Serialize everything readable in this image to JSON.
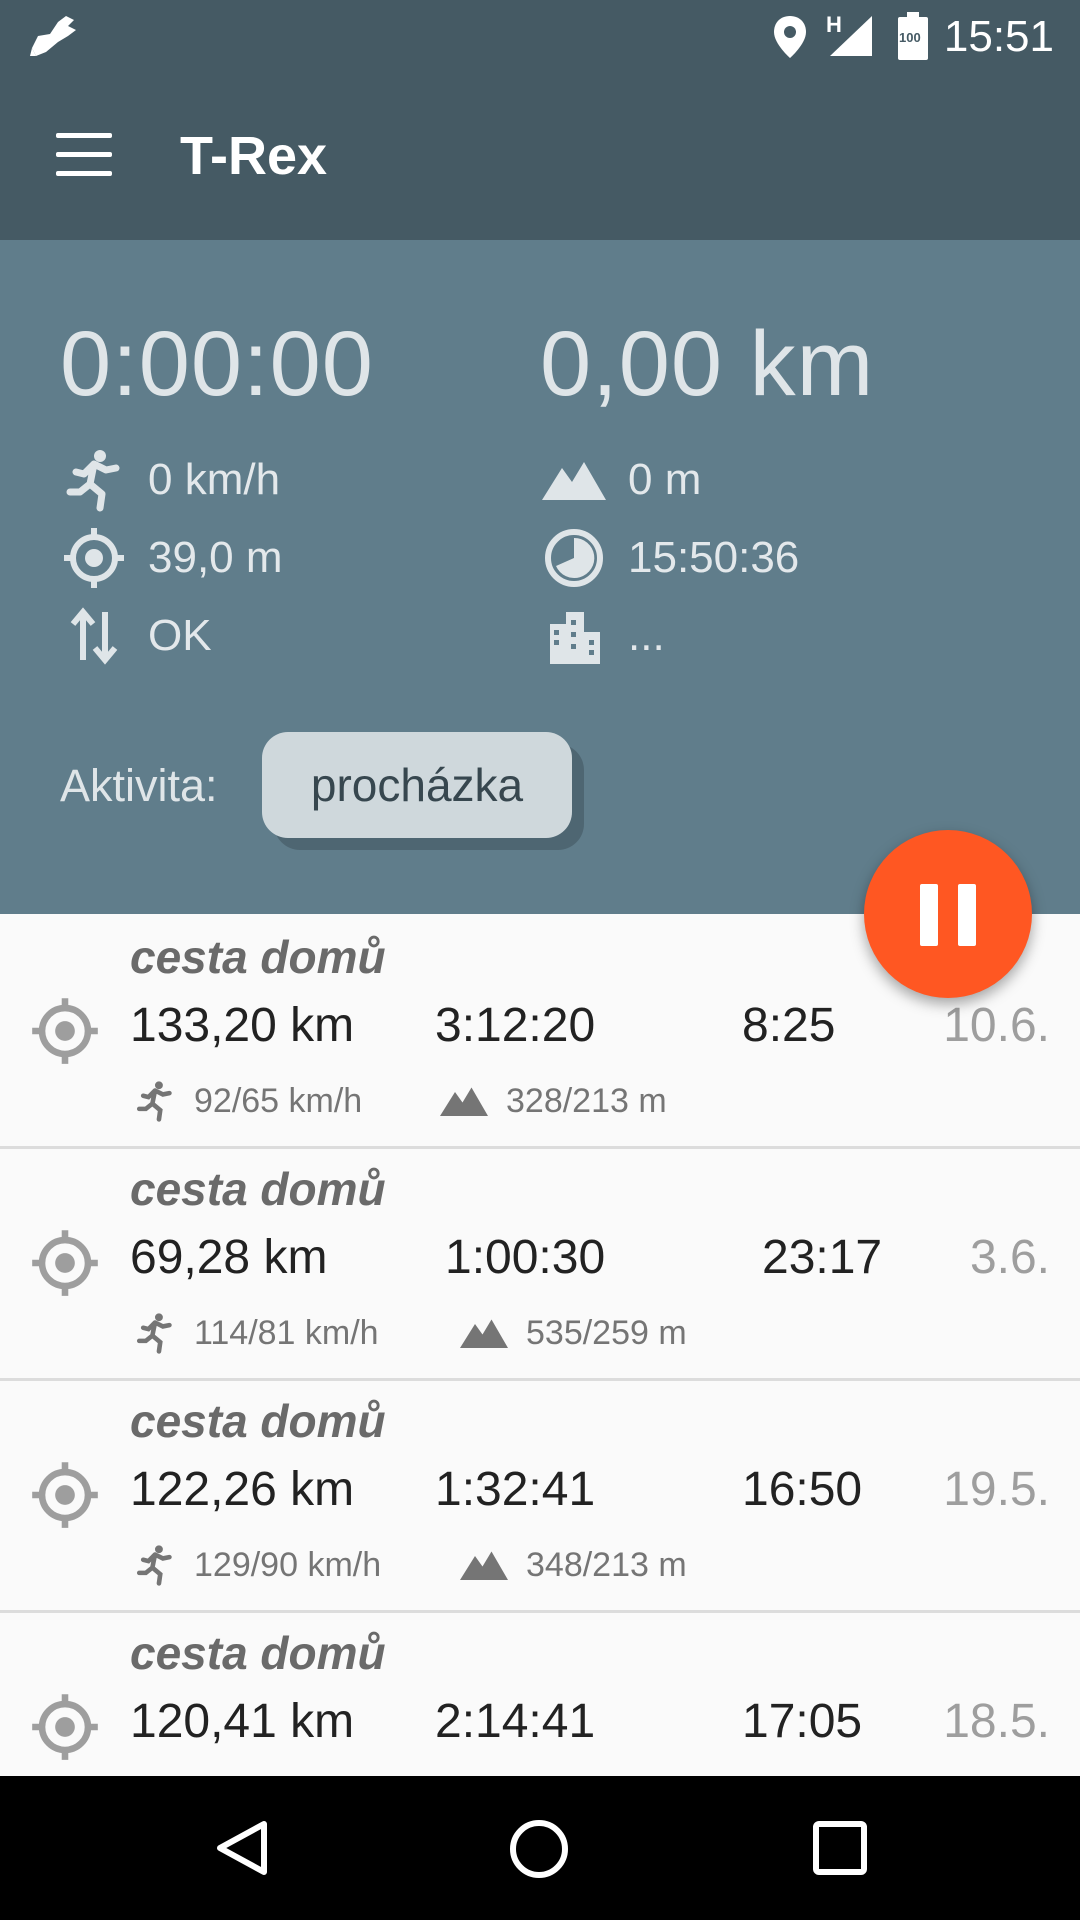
{
  "status_bar": {
    "time": "15:51",
    "network": "H",
    "battery": "100"
  },
  "app_bar": {
    "title": "T-Rex"
  },
  "stats": {
    "elapsed": "0:00:00",
    "distance": "0,00 km",
    "speed": "0 km/h",
    "accuracy": "39,0 m",
    "sync": "OK",
    "altitude": "0 m",
    "clock": "15:50:36",
    "location": "..."
  },
  "activity": {
    "label": "Aktivita:",
    "value": "procházka"
  },
  "trips": [
    {
      "title": "cesta domů",
      "distance": "133,20 km",
      "duration": "3:12:20",
      "pace": "8:25",
      "date": "10.6.",
      "speed": "92/65 km/h",
      "elevation": "328/213 m"
    },
    {
      "title": "cesta domů",
      "distance": "69,28 km",
      "duration": "1:00:30",
      "pace": "23:17",
      "date": "3.6.",
      "speed": "114/81 km/h",
      "elevation": "535/259 m"
    },
    {
      "title": "cesta domů",
      "distance": "122,26 km",
      "duration": "1:32:41",
      "pace": "16:50",
      "date": "19.5.",
      "speed": "129/90 km/h",
      "elevation": "348/213 m"
    },
    {
      "title": "cesta domů",
      "distance": "120,41 km",
      "duration": "2:14:41",
      "pace": "17:05",
      "date": "18.5.",
      "speed": "",
      "elevation": ""
    }
  ],
  "colors": {
    "primary": "#455a64",
    "panel": "#607d8b",
    "accent": "#ff5722",
    "chip": "#cfd8dc"
  },
  "icons": [
    "shoe-icon",
    "location-pin-icon",
    "signal-icon",
    "battery-icon",
    "menu-icon",
    "runner-icon",
    "mountain-icon",
    "crosshair-icon",
    "clock-icon",
    "sync-arrows-icon",
    "building-icon",
    "pause-icon",
    "back-icon",
    "home-icon",
    "recents-icon"
  ]
}
